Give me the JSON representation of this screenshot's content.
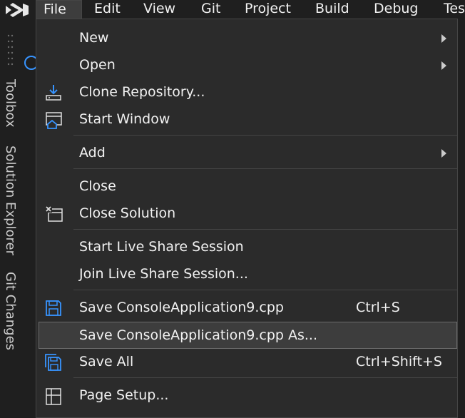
{
  "menubar": {
    "items": [
      {
        "label": "File"
      },
      {
        "label": "Edit"
      },
      {
        "label": "View"
      },
      {
        "label": "Git"
      },
      {
        "label": "Project"
      },
      {
        "label": "Build"
      },
      {
        "label": "Debug"
      },
      {
        "label": "Tes"
      }
    ],
    "active": "File"
  },
  "left_rail": {
    "tabs": [
      {
        "label": "Toolbox"
      },
      {
        "label": "Solution Explorer"
      },
      {
        "label": "Git Changes"
      }
    ]
  },
  "file_menu": {
    "items": [
      {
        "label": "New",
        "has_submenu": true,
        "icon": ""
      },
      {
        "label": "Open",
        "has_submenu": true,
        "icon": ""
      },
      {
        "label": "Clone Repository...",
        "icon": "clone-repository-icon"
      },
      {
        "label": "Start Window",
        "icon": "start-window-icon"
      },
      {
        "label": "Add",
        "has_submenu": true,
        "icon": ""
      },
      {
        "label": "Close",
        "icon": ""
      },
      {
        "label": "Close Solution",
        "icon": "close-solution-icon"
      },
      {
        "label": "Start Live Share Session",
        "icon": ""
      },
      {
        "label": "Join Live Share Session...",
        "icon": ""
      },
      {
        "label": "Save ConsoleApplication9.cpp",
        "shortcut": "Ctrl+S",
        "icon": "save-icon"
      },
      {
        "label": "Save ConsoleApplication9.cpp As...",
        "icon": "",
        "highlighted": true
      },
      {
        "label": "Save All",
        "shortcut": "Ctrl+Shift+S",
        "icon": "save-all-icon"
      },
      {
        "label": "Page Setup...",
        "icon": "page-setup-icon"
      }
    ]
  },
  "colors": {
    "background": "#1f1f1f",
    "menu_background": "#2b2b2b",
    "highlight": "#3d3d3d",
    "accent_blue": "#3794ff",
    "vs_logo_purple": "#c6a0f6",
    "text": "#f1f1f1"
  }
}
